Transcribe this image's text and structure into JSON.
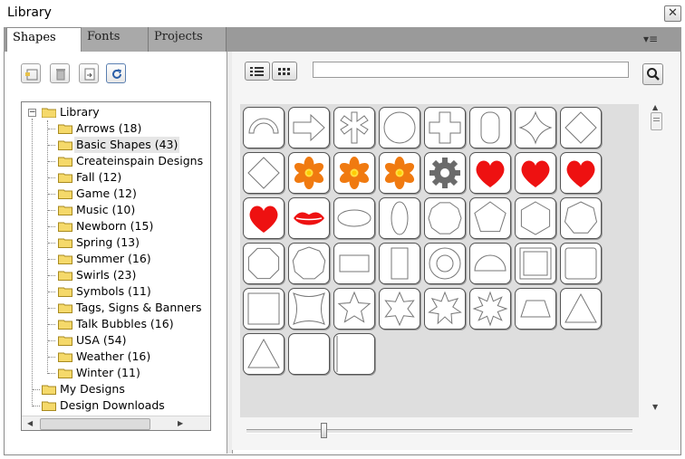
{
  "window": {
    "title": "Library",
    "close_glyph": "✕"
  },
  "tabs": [
    {
      "label": "Shapes",
      "active": true
    },
    {
      "label": "Fonts",
      "active": false
    },
    {
      "label": "Projects",
      "active": false
    }
  ],
  "tab_menu_glyph": "▾≡",
  "left_toolbar": [
    {
      "name": "new-folder-icon"
    },
    {
      "name": "delete-icon"
    },
    {
      "name": "import-icon"
    },
    {
      "name": "refresh-icon"
    }
  ],
  "tree": {
    "root": "Library",
    "root_expander": "−",
    "children": [
      "Arrows (18)",
      "Basic Shapes (43)",
      "Createinspain Designs",
      "Fall (12)",
      "Game (12)",
      "Music (10)",
      "Newborn (15)",
      "Spring (13)",
      "Summer (16)",
      "Swirls (23)",
      "Symbols (11)",
      "Tags, Signs & Banners",
      "Talk Bubbles (16)",
      "USA (54)",
      "Weather (16)",
      "Winter (11)"
    ],
    "selected": "Basic Shapes (43)",
    "top_level": [
      "My Designs",
      "Design Downloads"
    ]
  },
  "search": {
    "value": "",
    "placeholder": ""
  },
  "view_modes": [
    "list-view-icon",
    "grid-view-icon"
  ],
  "shapes": [
    "arc",
    "arrow-right",
    "asterisk",
    "circle",
    "cross",
    "rounded-rect-vertical",
    "four-point-star",
    "diamond",
    "diamond",
    "flower-orange",
    "flower-orange",
    "flower-orange",
    "gear",
    "heart-red",
    "heart-red",
    "heart-red",
    "heart-red",
    "lips-red",
    "ellipse-horizontal",
    "ellipse-vertical",
    "decagon",
    "pentagon",
    "hexagon",
    "heptagon",
    "octagon",
    "nonagon",
    "rectangle-horizontal",
    "rectangle-vertical",
    "ring",
    "semicircle",
    "square-frame",
    "square-rounded",
    "square",
    "four-point-star-concave",
    "five-point-star",
    "six-point-star",
    "seven-point-star",
    "eight-point-star",
    "trapezoid",
    "triangle",
    "triangle",
    "rounded-square-plain",
    "rounded-rect-left"
  ],
  "colors": {
    "orange": "#f07a10",
    "red": "#ee1111",
    "gray": "#6b6b6b",
    "outline": "#777777"
  },
  "slider": {
    "value": 0.2
  }
}
